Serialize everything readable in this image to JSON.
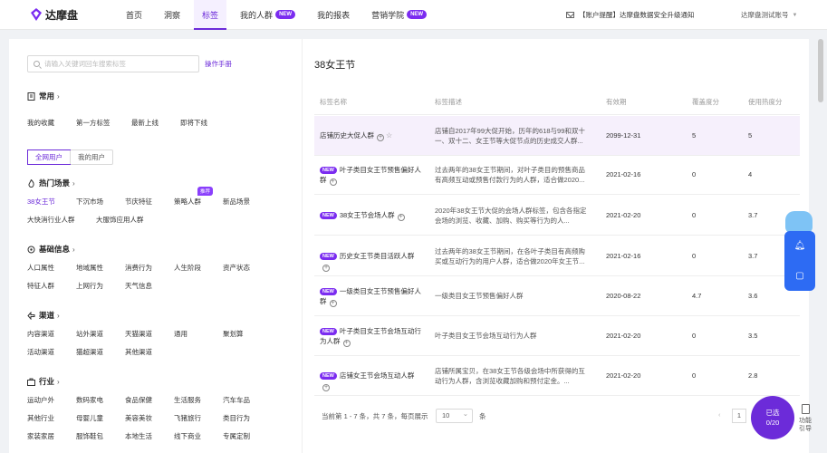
{
  "brand": "达摩盘",
  "nav": [
    {
      "label": "首页",
      "new": false,
      "active": false
    },
    {
      "label": "洞察",
      "new": false,
      "active": false
    },
    {
      "label": "标签",
      "new": false,
      "active": true
    },
    {
      "label": "我的人群",
      "new": true,
      "active": false
    },
    {
      "label": "我的报表",
      "new": false,
      "active": false
    },
    {
      "label": "营销学院",
      "new": true,
      "active": false
    }
  ],
  "new_badge": "NEW",
  "notice": "【账户提醒】达摩盘数据安全升级通知",
  "account": "达摩盘测试账号",
  "search": {
    "placeholder": "请输入关键词回车搜索标签",
    "manual": "操作手册"
  },
  "common": {
    "title": "常用",
    "tags": [
      "我的收藏",
      "第一方标签",
      "最新上线",
      "即将下线"
    ]
  },
  "scope_toggle": [
    "全网用户",
    "我的用户"
  ],
  "hot": {
    "title": "热门场景",
    "rows": [
      [
        "38女王节",
        "下沉市场",
        "节庆特征",
        "策略人群",
        "新品场景"
      ],
      [
        "大快消行业人群",
        "大服饰应用人群"
      ]
    ],
    "recommend_badge": "推荐"
  },
  "basic": {
    "title": "基础信息",
    "rows": [
      [
        "人口属性",
        "地域属性",
        "消费行为",
        "人生阶段",
        "资产状态"
      ],
      [
        "特征人群",
        "上网行为",
        "天气信息"
      ]
    ]
  },
  "channel": {
    "title": "渠道",
    "rows": [
      [
        "内容渠道",
        "站外渠道",
        "天猫渠道",
        "通用",
        "聚划算"
      ],
      [
        "活动渠道",
        "猫超渠道",
        "其他渠道"
      ]
    ]
  },
  "industry": {
    "title": "行业",
    "rows": [
      [
        "运动户外",
        "数码家电",
        "食品保健",
        "生活服务",
        "汽车车品"
      ],
      [
        "其他行业",
        "母婴儿童",
        "美容美妆",
        "飞猪旅行",
        "类目行为"
      ],
      [
        "家装家居",
        "服饰鞋包",
        "本地生活",
        "线下商业",
        "专属定制"
      ]
    ]
  },
  "panel_title": "38女王节",
  "headers": {
    "name": "标签名称",
    "desc": "标签描述",
    "date": "有效期",
    "cov": "覆盖度分",
    "heat": "使用热度分"
  },
  "rows": [
    {
      "new": false,
      "name": "店铺历史大促人群",
      "desc": "店铺自2017年99大促开始，历年的618与99和双十一、双十二、女王节等大促节点的历史成交人群...",
      "date": "2099-12-31",
      "cov": "5",
      "heat": "5"
    },
    {
      "new": true,
      "name": "叶子类目女王节预售偏好人群",
      "desc": "过去两年的38女王节期间，对叶子类目的预售商品有高频互动或预售付款行为的人群，适合做2020...",
      "date": "2021-02-16",
      "cov": "0",
      "heat": "4"
    },
    {
      "new": true,
      "name": "38女王节会场人群",
      "desc": "2020年38女王节大促的会场人群标签，包含各指定会场的浏览、收藏、加购、购买等行为的人...",
      "date": "2021-02-20",
      "cov": "0",
      "heat": "3.7"
    },
    {
      "new": true,
      "name": "历史女王节类目活跃人群",
      "desc": "过去两年的38女王节期间，在各叶子类目有高频购买或互动行为的用户人群，适合做2020年女王节...",
      "date": "2021-02-16",
      "cov": "0",
      "heat": "3.7"
    },
    {
      "new": true,
      "name": "一级类目女王节预售偏好人群",
      "desc": "一级类目女王节预售偏好人群",
      "date": "2020-08-22",
      "cov": "4.7",
      "heat": "3.6"
    },
    {
      "new": true,
      "name": "叶子类目女王节会场互动行为人群",
      "desc": "叶子类目女王节会场互动行为人群",
      "date": "2021-02-20",
      "cov": "0",
      "heat": "3.5"
    },
    {
      "new": true,
      "name": "店铺女王节会场互动人群",
      "desc": "店铺所属宝贝，在38女王节各级会场中所获得的互动行为人群，含浏览收藏加购和预付定金。...",
      "date": "2021-02-20",
      "cov": "0",
      "heat": "2.8"
    }
  ],
  "pager": {
    "info": "当前第 1 - 7 条，共 7 条，每页展示",
    "size": "10",
    "unit": "条",
    "prev": "‹",
    "page": "1"
  },
  "selected": {
    "line1": "已选",
    "line2": "0/20"
  },
  "guide": {
    "line1": "功能",
    "line2": "引导"
  }
}
